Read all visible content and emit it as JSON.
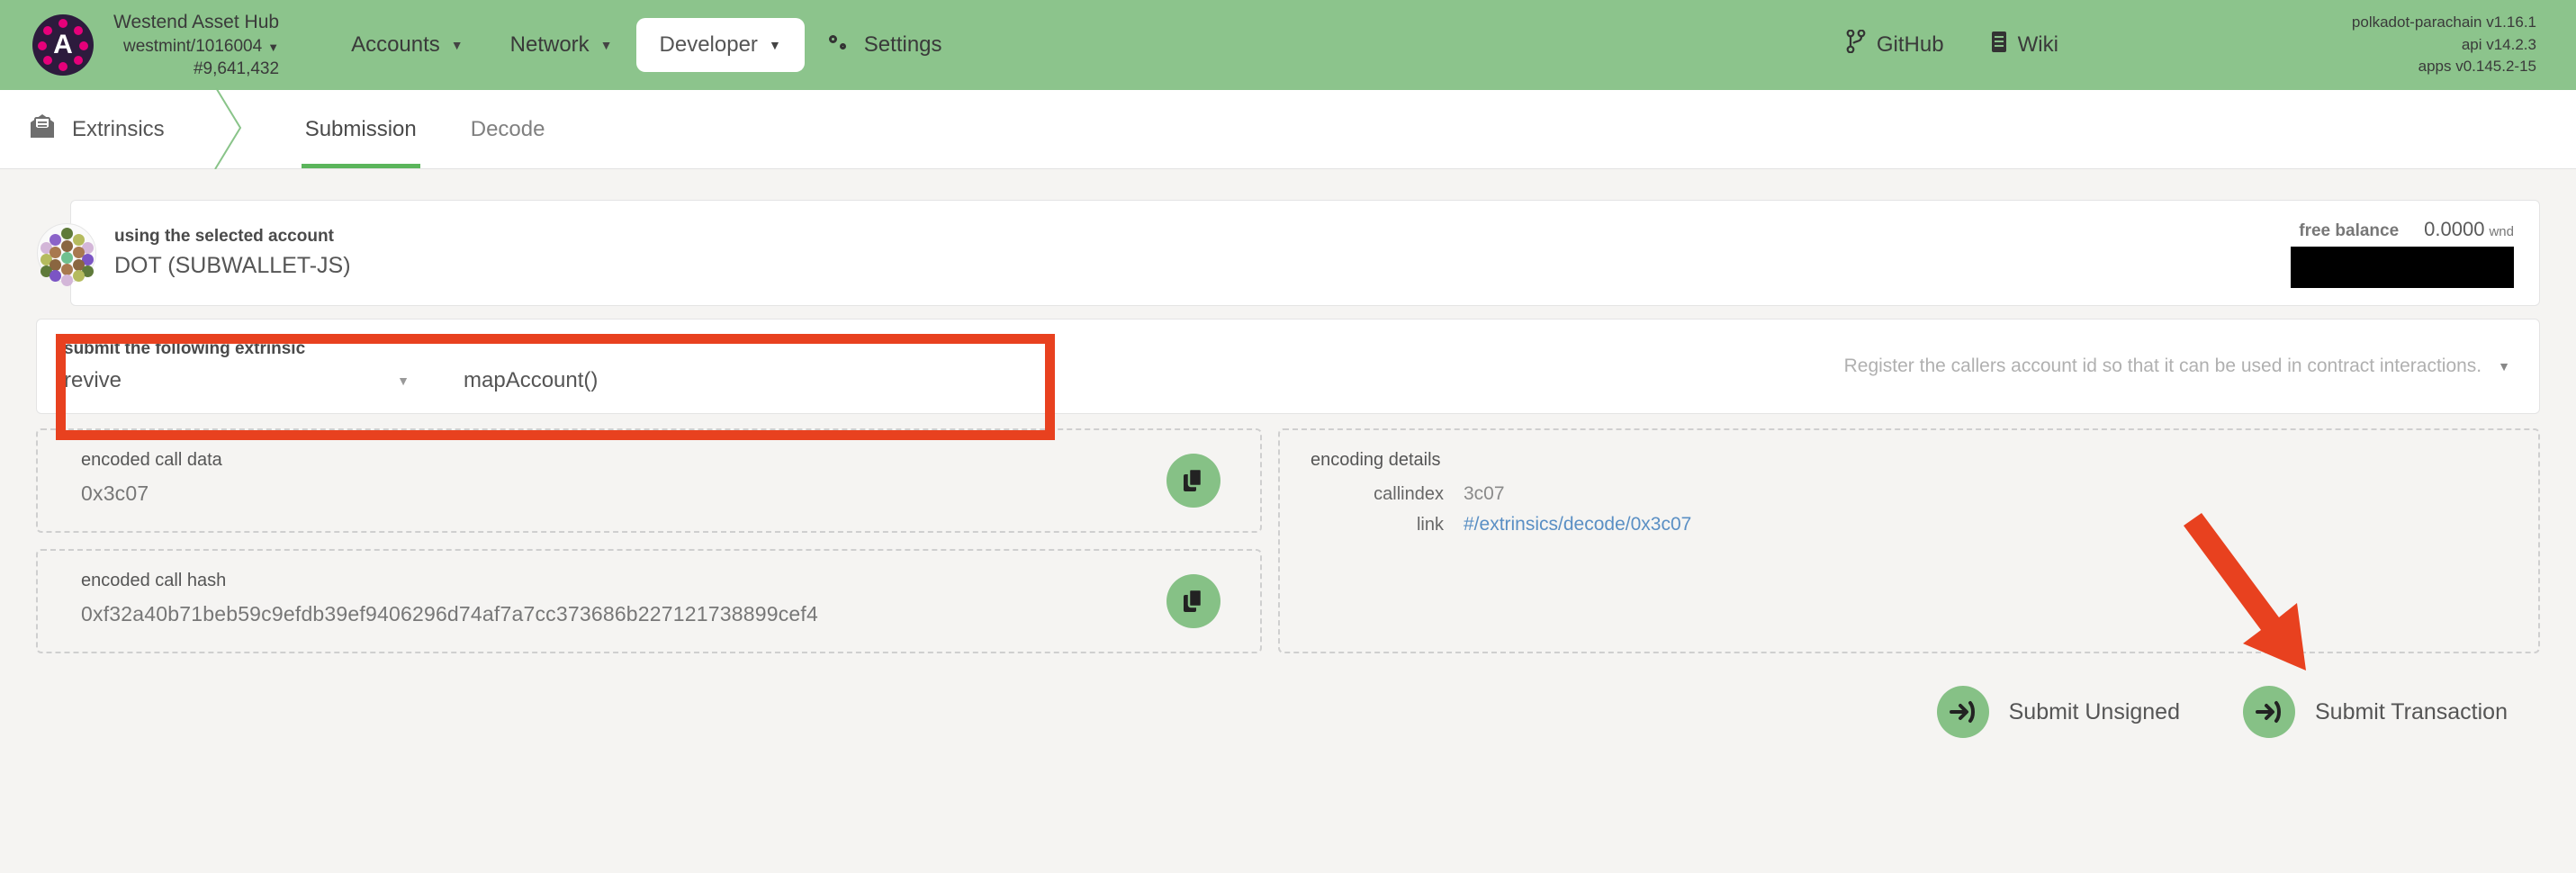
{
  "header": {
    "logo_letter": "A",
    "chain": {
      "name": "Westend Asset Hub",
      "endpoint": "westmint/1016004",
      "block": "#9,641,432",
      "caret": "▼"
    },
    "nav": [
      {
        "label": "Accounts",
        "icon": "",
        "caret": "▼",
        "active": false
      },
      {
        "label": "Network",
        "icon": "",
        "caret": "▼",
        "active": false
      },
      {
        "label": "Developer",
        "icon": "",
        "caret": "▼",
        "active": true
      },
      {
        "label": "Settings",
        "icon": "gear-icon",
        "caret": "",
        "active": false
      }
    ],
    "links": [
      {
        "label": "GitHub",
        "icon": "git-branch-icon"
      },
      {
        "label": "Wiki",
        "icon": "book-icon"
      }
    ],
    "versions": {
      "runtime": "polkadot-parachain v1.16.1",
      "api": "api v14.2.3",
      "apps": "apps v0.145.2-15"
    },
    "bg_color": "#8cc48c"
  },
  "tabbar": {
    "section_label": "Extrinsics",
    "section_icon": "envelope-icon",
    "tabs": [
      {
        "label": "Submission",
        "active": true
      },
      {
        "label": "Decode",
        "active": false
      }
    ],
    "active_underline_color": "#5bb55b"
  },
  "account": {
    "label": "using the selected account",
    "value": "DOT (SUBWALLET-JS)",
    "balance_label": "free balance",
    "balance_value": "0.0000",
    "balance_unit": "wnd",
    "redacted": true
  },
  "extrinsic": {
    "label": "submit the following extrinsic",
    "pallet": "revive",
    "method": "mapAccount()",
    "caret": "▼",
    "description": "Register the callers account id so that it can be used in contract interactions.",
    "highlight_color": "#e8411f"
  },
  "encoded": {
    "call_data_label": "encoded call data",
    "call_data_value": "0x3c07",
    "call_hash_label": "encoded call hash",
    "call_hash_value": "0xf32a40b71beb59c9efdb39ef9406296d74af7a7cc373686b227121738899cef4",
    "copy_icon": "copy-icon"
  },
  "encoding_details": {
    "title": "encoding details",
    "rows": [
      {
        "key": "callindex",
        "value": "3c07",
        "is_link": false
      },
      {
        "key": "link",
        "value": "#/extrinsics/decode/0x3c07",
        "is_link": true
      }
    ],
    "link_color": "#5a8fc4"
  },
  "actions": {
    "submit_unsigned": "Submit Unsigned",
    "submit_transaction": "Submit Transaction",
    "icon": "sign-in-arrow-icon",
    "button_color": "#86c186"
  },
  "annotations": {
    "arrow_color": "#e8411f",
    "box_color": "#e8411f",
    "arrow_target": "submit-transaction-button",
    "box_target": "extrinsic-selector"
  }
}
